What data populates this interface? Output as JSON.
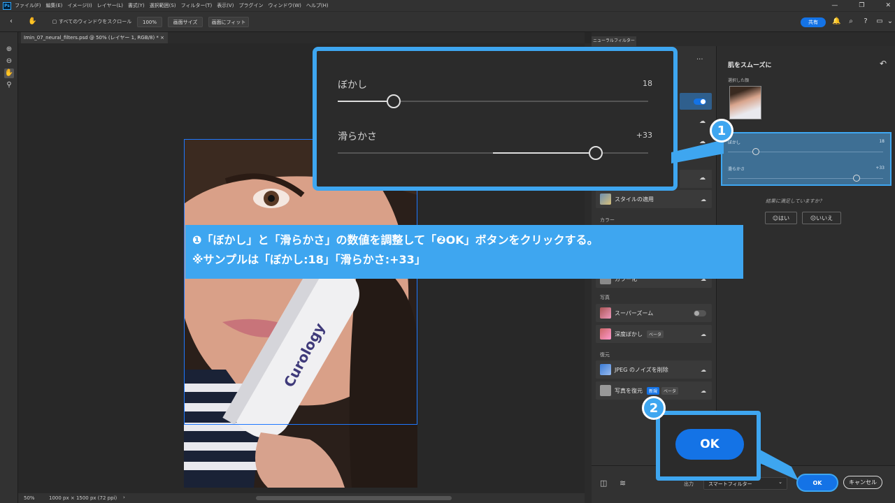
{
  "app": {
    "logo": "Ps",
    "menu": [
      "ファイル(F)",
      "編集(E)",
      "イメージ(I)",
      "レイヤー(L)",
      "書式(Y)",
      "選択範囲(S)",
      "フィルター(T)",
      "表示(V)",
      "プラグイン",
      "ウィンドウ(W)",
      "ヘルプ(H)"
    ],
    "window_buttons": [
      "—",
      "❐",
      "✕"
    ]
  },
  "options": {
    "scroll_all": "すべてのウィンドウをスクロール",
    "zoom": "100%",
    "fit_screen": "画面サイズ",
    "fill_screen": "画面にフィット",
    "share": "共有"
  },
  "document": {
    "tab": "Imin_07_neural_filters.psd @ 50% (レイヤー 1, RGB/8) *",
    "close": "×",
    "product_text": "Curology"
  },
  "status": {
    "zoom": "50%",
    "size": "1000 px × 1500 px (72 ppi)",
    "arrow": "›"
  },
  "panel": {
    "tab": "ニューラルフィルター",
    "filter_title": "肌をスムーズに",
    "selected_face_label": "選択した顔",
    "blur_label": "ぼかし",
    "blur_value": "18",
    "smooth_label": "滑らかさ",
    "smooth_value": "+33",
    "feedback_q": "結果に満足していますか？",
    "yes": "はい",
    "no": "いいえ",
    "cat_color": "カラー",
    "cat_photo": "写真",
    "cat_restore": "復元",
    "beta": "ベータ",
    "new": "新規",
    "items": {
      "style": "スタイルの適用",
      "colorize": "カラー化",
      "superzoom": "スーパーズーム",
      "depth": "深度ぼかし",
      "jpeg": "JPEG のノイズを削除",
      "restore": "写真を復元"
    },
    "output_label": "出力",
    "output_value": "スマートフィルター",
    "ok": "OK",
    "cancel": "キャンセル"
  },
  "zoom_callout": {
    "blur_label": "ぼかし",
    "blur_value": "18",
    "blur_level": 0.18,
    "smooth_label": "滑らかさ",
    "smooth_value": "+33",
    "smooth_level": 0.83
  },
  "callout": {
    "n1": "1",
    "n2": "2",
    "ok_big": "OK",
    "line1": "❶「ぼかし」と「滑らかさ」の数値を調整して「❷OK」ボタンをクリックする。",
    "line2": "※サンプルは「ぼかし:18」「滑らかさ:+33」"
  },
  "colors": {
    "accent": "#3ea6f0",
    "primary": "#1473e6"
  },
  "icons": [
    "hand-icon",
    "zoom-icon",
    "bell-icon",
    "help-icon",
    "cloud-icon",
    "undo-icon"
  ]
}
